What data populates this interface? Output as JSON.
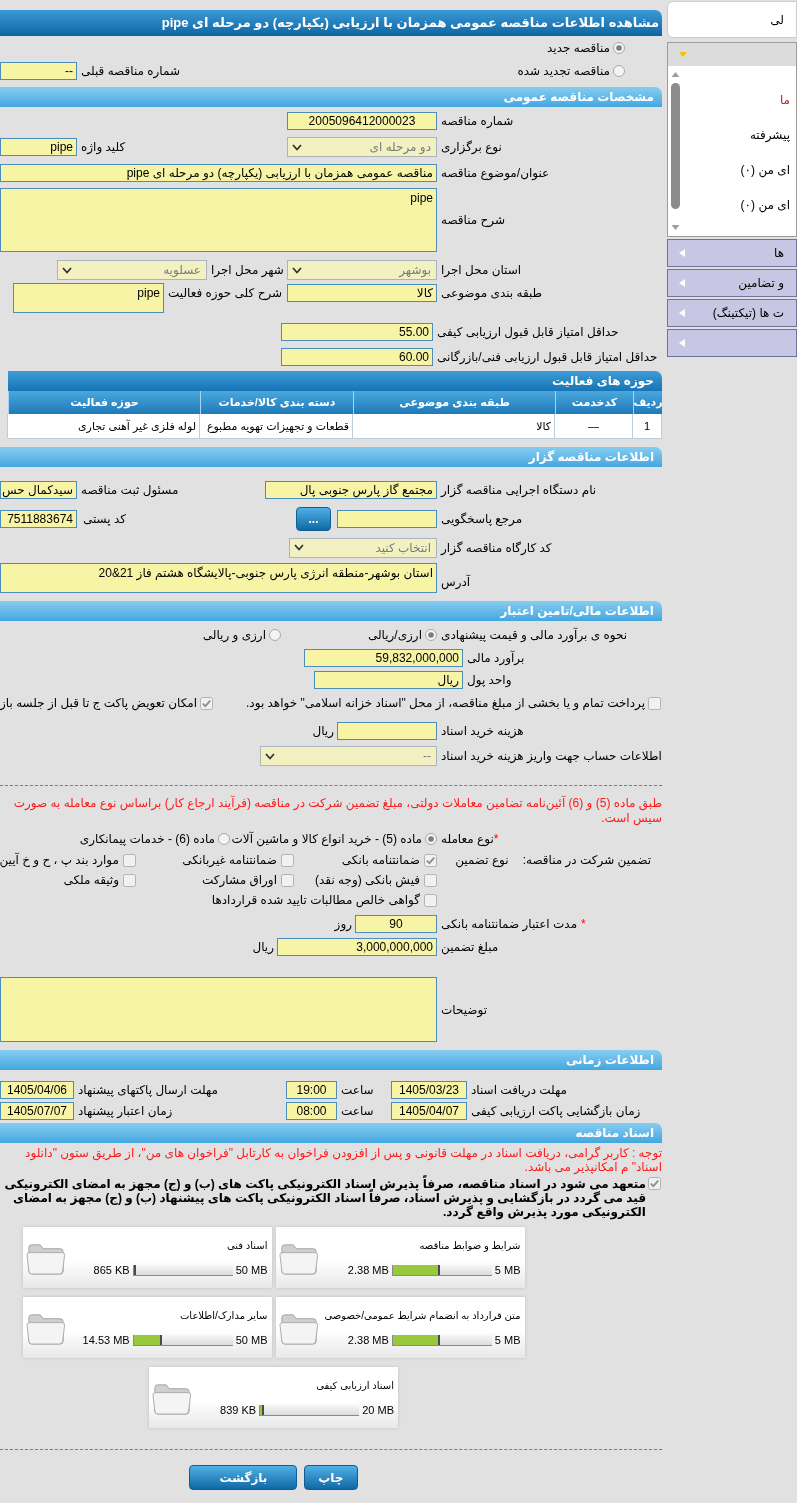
{
  "sidebar": {
    "tab": "لی",
    "panel": {
      "expanded": true,
      "items": [
        {
          "label": "ما",
          "color": "#a52a2a"
        },
        {
          "label": "پیشرفته",
          "color": "#000000"
        },
        {
          "label": "ای من (۰)",
          "color": "#000000"
        },
        {
          "label": "ای من (۰)",
          "color": "#000000"
        }
      ]
    },
    "menu": [
      {
        "label": "ها",
        "expanded": false
      },
      {
        "label": "و تضامین",
        "expanded": false
      },
      {
        "label": "ت ها (تیکتینگ)",
        "expanded": false
      },
      {
        "expanded": false
      }
    ]
  },
  "title": "مشاهده اطلاعات مناقصه عمومی همزمان با ارزیابی (یکپارچه) دو مرحله ای pipe",
  "tender_type": {
    "options": [
      {
        "label": "مناقصه جدید",
        "selected": true
      },
      {
        "label": "مناقصه تجدید شده",
        "selected": false
      }
    ]
  },
  "previous_tender": {
    "label": "شماره مناقصه قبلی",
    "value": "--"
  },
  "general": {
    "heading": "مشخصات مناقصه عمومی",
    "tender_number": {
      "label": "شماره مناقصه",
      "value": "2005096412000023"
    },
    "holding_type": {
      "label": "نوع برگزاری",
      "value": "دو مرحله ای"
    },
    "keyword": {
      "label": "کلید واژه",
      "value": "pipe"
    },
    "subject": {
      "label": "عنوان/موضوع مناقصه",
      "value": "مناقصه عمومی همزمان با ارزیابی (یکپارچه) دو مرحله ای pipe"
    },
    "description": {
      "label": "شرح مناقصه",
      "value": "pipe"
    },
    "province": {
      "label": "استان محل اجرا",
      "value": "بوشهر"
    },
    "city": {
      "label": "شهر محل اجرا",
      "value": "عسلویه"
    },
    "classification": {
      "label": "طبقه بندی موضوعی",
      "value": "کالا"
    },
    "activity_description": {
      "label": "شرح کلی حوزه فعالیت",
      "value": "pipe"
    },
    "min_quality_score": {
      "label": "حداقل امتیاز قابل قبول ارزیابی کیفی",
      "value": "55.00"
    },
    "min_technical_score": {
      "label": "حداقل امتیاز قابل قبول ارزیابی فنی/بازرگانی",
      "value": "60.00"
    }
  },
  "activity_areas": {
    "heading": "حوزه های فعالیت",
    "columns": [
      "ردیف",
      "کدخدمت",
      "طبقه بندی موضوعی",
      "دسته بندی کالا/خدمات",
      "حوزه فعالیت"
    ],
    "rows": [
      [
        "1",
        "—",
        "کالا",
        "قطعات و تجهیزات تهویه مطبوع",
        "لوله فلزی غیر آهنی تجاری"
      ]
    ]
  },
  "tenderer": {
    "heading": "اطلاعات مناقصه گزار",
    "agency": {
      "label": "نام دستگاه اجرایی مناقصه گزار",
      "value": "مجتمع گاز پارس جنوبی پال"
    },
    "registrar": {
      "label": "مسئول ثبت مناقصه",
      "value": "سیدکمال حس"
    },
    "reference": {
      "label": "مرجع پاسخگویی",
      "button": "..."
    },
    "postal_code": {
      "label": "کد پستی",
      "value": "7511883674"
    },
    "workshop_code": {
      "label": "کد کارگاه مناقصه گزار",
      "value": "انتخاب کنید"
    },
    "address": {
      "label": "آدرس",
      "value": "استان بوشهر-منطقه انرژی پارس جنوبی-پالایشگاه هشتم فاز 21&20"
    }
  },
  "finance": {
    "heading": "اطلاعات مالی/تامین اعتبار",
    "method": {
      "label": "نحوه ی برآورد مالی و قیمت پیشنهادی",
      "options": [
        {
          "label": "ارزی/ریالی",
          "selected": true
        },
        {
          "label": "ارزی و ریالی",
          "selected": false
        }
      ]
    },
    "estimate": {
      "label": "برآورد مالی",
      "value": "59,832,000,000"
    },
    "currency": {
      "label": "واحد پول",
      "value": "ریال"
    },
    "options": [
      {
        "label": "پرداخت تمام و یا بخشی از مبلغ مناقصه، از محل \"اسناد خزانه اسلامی\" خواهد بود.",
        "checked": false
      },
      {
        "label": "امکان تعویض پاکت ج تا قبل از جلسه باز",
        "checked": true
      }
    ],
    "document_fee": {
      "label": "هزینه خرید اسناد",
      "unit": "ریال"
    },
    "account": {
      "label": "اطلاعات حساب جهت واریز هزینه خرید اسناد",
      "value": "--"
    }
  },
  "guarantee": {
    "notice": "طبق ماده (5) و (6) آئین‌نامه تضامین معاملات دولتی، مبلغ تضمین شرکت در مناقصه (فرآیند ارجاع کار) براساس نوع معامله به صورت سیس است.",
    "deal_type": {
      "mark": "*",
      "label": "نوع معامله",
      "options": [
        {
          "label": "ماده (5) - خرید انواع کالا و ماشین آلات",
          "selected": true
        },
        {
          "label": "ماده (6) - خدمات پیمانکاری",
          "selected": false
        }
      ]
    },
    "label": "تضمین شرکت در مناقصه:",
    "type_label": "نوع تضمین",
    "options": [
      {
        "label": "ضمانتنامه بانکی",
        "checked": true
      },
      {
        "label": "ضمانتنامه غیربانکی",
        "checked": false
      },
      {
        "label": "موارد بند پ ، ح و خ آیین",
        "checked": false
      },
      {
        "label": "فیش بانکی (وجه نقد)",
        "checked": false
      },
      {
        "label": "اوراق مشارکت",
        "checked": false
      },
      {
        "label": "وثیقه ملکی",
        "checked": false
      },
      {
        "label": "گواهی خالص مطالبات تایید شده قراردادها",
        "checked": false
      }
    ],
    "validity": {
      "mark": "*",
      "label": "مدت اعتبار ضمانتنامه بانکی",
      "value": "90",
      "unit": "روز"
    },
    "amount": {
      "label": "مبلغ تضمین",
      "value": "3,000,000,000",
      "unit": "ریال"
    },
    "notes": {
      "label": "توضیحات"
    }
  },
  "schedule": {
    "heading": "اطلاعات زمانی",
    "rows": [
      {
        "label": "مهلت دریافت اسناد",
        "date": "1405/03/23",
        "time_label": "ساعت",
        "time": "19:00",
        "label_2": "مهلت ارسال پاکتهای پیشنهاد",
        "date_2": "1405/04/06"
      },
      {
        "label": "زمان بازگشایی پاکت ارزیابی کیفی",
        "date": "1405/04/07",
        "time_label": "ساعت",
        "time": "08:00",
        "label_2": "زمان اعتبار پیشنهاد",
        "date_2": "1405/07/07"
      }
    ]
  },
  "documents": {
    "heading": "اسناد مناقصه",
    "notice": "توجه : کاربر گرامی، دریافت اسناد در مهلت قانونی و پس از افزودن فراخوان به کارتابل \"فراخوان های من\"، از طریق ستون \"دانلود اسناد\" م امکانپذیر می باشد.",
    "commitment": {
      "text": "متعهد می شود در اسناد مناقصه، صرفاً پذیرش اسناد الکترونیکی پاکت های (ب) و (ج) مجهز به امضای الکترونیکی قید می گردد در بازگشایی و پذیرش اسناد، صرفاً اسناد الکترونیکی پاکت های پیشنهاد (ب) و (ج) مجهز به امضای الکترونیکی مورد پذیرش واقع گردد.",
      "checked": true
    },
    "files": [
      {
        "name": "شرایط و ضوابط مناقصه",
        "size": "2.38 MB",
        "level": 0.48,
        "limit": "5 MB"
      },
      {
        "name": "اسناد فنی",
        "size": "865 KB",
        "level": 0.02,
        "limit": "50 MB"
      },
      {
        "name": "متن قرارداد به انضمام شرایط عمومی/خصوصی",
        "size": "2.38 MB",
        "level": 0.48,
        "limit": "5 MB"
      },
      {
        "name": "سایر مدارک/اطلاعات",
        "size": "14.53 MB",
        "level": 0.29,
        "limit": "50 MB"
      },
      {
        "name": "اسناد ارزیابی کیفی",
        "size": "839 KB",
        "level": 0.04,
        "limit": "20 MB"
      }
    ]
  },
  "buttons": [
    {
      "kind": "print",
      "label": "چاپ"
    },
    {
      "kind": "back",
      "label": "بازگشت"
    }
  ]
}
